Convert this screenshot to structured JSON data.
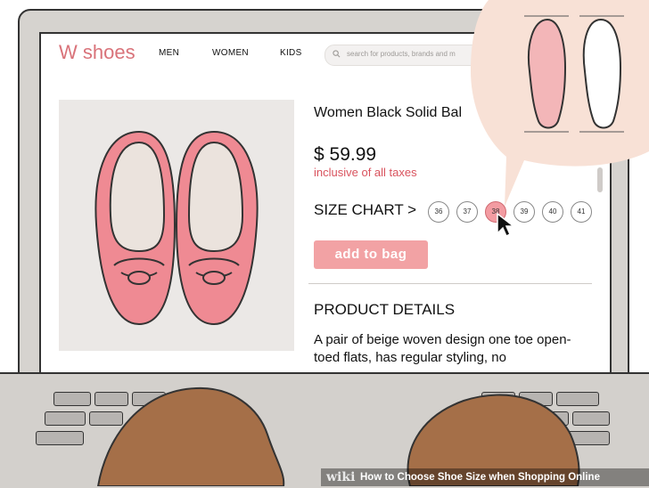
{
  "site": {
    "logo": "W shoes",
    "nav": [
      "MEN",
      "WOMEN",
      "KIDS"
    ],
    "search_placeholder": "search for products, brands and m"
  },
  "product": {
    "title": "Women Black Solid Bal",
    "price": "$ 59.99",
    "tax_note": "inclusive of all taxes",
    "size_chart_label": "SIZE CHART >",
    "sizes": [
      "36",
      "37",
      "38",
      "39",
      "40",
      "41"
    ],
    "selected_size": "38",
    "add_button": "add to bag",
    "details_heading": "PRODUCT DETAILS",
    "description": "A pair of beige woven design one toe open-toed flats, has regular styling, no"
  },
  "caption": {
    "brand": "wiki",
    "text": "How to Choose Shoe Size when Shopping Online"
  },
  "colors": {
    "accent": "#d9737a",
    "price_note": "#d9535e",
    "button": "#f2a2a4",
    "selected_size": "#f39ca2"
  }
}
